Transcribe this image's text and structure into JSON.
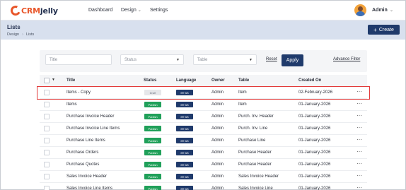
{
  "brand": {
    "prefix": "CRM",
    "name": "jelly"
  },
  "nav": {
    "items": [
      {
        "label": "Dashboard"
      },
      {
        "label": "Design"
      },
      {
        "label": "Settings"
      }
    ],
    "user": "Admin"
  },
  "page": {
    "title": "Lists",
    "breadcrumb": [
      "Design",
      "Lists"
    ],
    "create_label": "Create"
  },
  "filters": {
    "title_placeholder": "Title",
    "status_placeholder": "Status",
    "table_placeholder": "Table",
    "reset_label": "Reset",
    "apply_label": "Apply",
    "advance_label": "Advance Filter"
  },
  "table": {
    "columns": [
      "Title",
      "Status",
      "Language",
      "Owner",
      "Table",
      "Created On"
    ],
    "rows": [
      {
        "title": "Items - Copy",
        "status": "Draft",
        "language": "en-us",
        "owner": "Admin",
        "table": "Item",
        "created": "02-February-2026"
      },
      {
        "title": "Items",
        "status": "Publish",
        "language": "en-us",
        "owner": "Admin",
        "table": "Item",
        "created": "01-January-2026"
      },
      {
        "title": "Purchase Invoice Header",
        "status": "Publish",
        "language": "en-us",
        "owner": "Admin",
        "table": "Purch. Inv. Header",
        "created": "01-January-2026"
      },
      {
        "title": "Purchase Invoice Line Items",
        "status": "Publish",
        "language": "en-us",
        "owner": "Admin",
        "table": "Purch. Inv. Line",
        "created": "01-January-2026"
      },
      {
        "title": "Purchase Line Items",
        "status": "Publish",
        "language": "en-us",
        "owner": "Admin",
        "table": "Purchase Line",
        "created": "01-January-2026"
      },
      {
        "title": "Purchase Orders",
        "status": "Publish",
        "language": "en-us",
        "owner": "Admin",
        "table": "Purchase Header",
        "created": "01-January-2026"
      },
      {
        "title": "Purchase Quotes",
        "status": "Publish",
        "language": "en-us",
        "owner": "Admin",
        "table": "Purchase Header",
        "created": "01-January-2026"
      },
      {
        "title": "Sales Invoice Header",
        "status": "Publish",
        "language": "en-us",
        "owner": "Admin",
        "table": "Sales Invoice Header",
        "created": "01-January-2026"
      },
      {
        "title": "Sales Invoice Line Items",
        "status": "Publish",
        "language": "en-us",
        "owner": "Admin",
        "table": "Sales Invoice Line",
        "created": "01-January-2026"
      }
    ]
  },
  "colors": {
    "brand_orange": "#e8562a",
    "navy": "#1f3a6b",
    "publish_green": "#20a05a",
    "highlight_red": "#e23b3b"
  },
  "icons": [
    "chevron-down-icon",
    "plus-icon",
    "more-icon",
    "avatar"
  ]
}
